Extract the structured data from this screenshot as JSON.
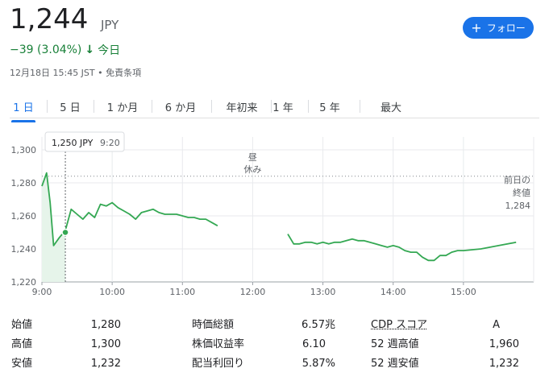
{
  "quote": {
    "price": "1,244",
    "currency": "JPY",
    "change": "−39 (3.04%)",
    "arrow": "↓",
    "period": "今日",
    "meta": "12月18日 15:45 JST • 免責条項"
  },
  "follow_button": {
    "icon": "+",
    "label": "フォロー"
  },
  "tabs": [
    {
      "label": "1 日",
      "active": true
    },
    {
      "label": "5 日",
      "active": false
    },
    {
      "label": "1 か月",
      "active": false
    },
    {
      "label": "6 か月",
      "active": false
    },
    {
      "label": "年初来",
      "active": false
    },
    {
      "label": "1 年",
      "active": false
    },
    {
      "label": "5 年",
      "active": false
    },
    {
      "label": "最大",
      "active": false
    }
  ],
  "chart_data": {
    "type": "line",
    "x_tick_labels": [
      "9:00",
      "10:00",
      "11:00",
      "12:00",
      "13:00",
      "14:00",
      "15:00"
    ],
    "y_tick_labels": [
      "1,300",
      "1,280",
      "1,260",
      "1,240",
      "1,220"
    ],
    "ylim": [
      1220,
      1300
    ],
    "previous_close": 1284,
    "previous_close_label": [
      "前日の",
      "終値",
      "1,284"
    ],
    "lunch_break_label": [
      "昼",
      "休み"
    ],
    "tooltip": {
      "price": "1,250 JPY",
      "time": "9:20"
    },
    "tooltip_point": {
      "x": "9:20",
      "y": 1250
    },
    "line_color": "#34a853",
    "fill_color": "#e6f4ea",
    "grid": true,
    "morning_session": {
      "x": [
        "9:00",
        "9:02",
        "9:04",
        "9:07",
        "9:10",
        "9:15",
        "9:20",
        "9:25",
        "9:30",
        "9:35",
        "9:40",
        "9:45",
        "9:50",
        "9:55",
        "10:00",
        "10:05",
        "10:10",
        "10:15",
        "10:20",
        "10:25",
        "10:30",
        "10:35",
        "10:40",
        "10:45",
        "10:50",
        "10:55",
        "11:00",
        "11:05",
        "11:10",
        "11:15",
        "11:20",
        "11:25",
        "11:30"
      ],
      "y": [
        1278,
        1282,
        1286,
        1268,
        1242,
        1247,
        1251,
        1264,
        1261,
        1258,
        1262,
        1259,
        1267,
        1266,
        1268,
        1265,
        1263,
        1261,
        1258,
        1262,
        1263,
        1264,
        1262,
        1261,
        1261,
        1261,
        1260,
        1259,
        1259,
        1258,
        1258,
        1256,
        1254
      ]
    },
    "afternoon_session": {
      "x": [
        "12:30",
        "12:35",
        "12:40",
        "12:45",
        "12:50",
        "12:55",
        "13:00",
        "13:05",
        "13:10",
        "13:15",
        "13:20",
        "13:25",
        "13:30",
        "13:35",
        "13:40",
        "13:45",
        "13:50",
        "13:55",
        "14:00",
        "14:05",
        "14:10",
        "14:15",
        "14:20",
        "14:25",
        "14:30",
        "14:35",
        "14:40",
        "14:45",
        "14:50",
        "14:55",
        "15:00",
        "15:15",
        "15:30",
        "15:45"
      ],
      "y": [
        1249,
        1243,
        1243,
        1244,
        1244,
        1243,
        1244,
        1243,
        1244,
        1244,
        1245,
        1246,
        1245,
        1245,
        1244,
        1243,
        1242,
        1241,
        1242,
        1241,
        1239,
        1238,
        1238,
        1235,
        1233,
        1233,
        1236,
        1236,
        1238,
        1239,
        1239,
        1240,
        1242,
        1244
      ]
    }
  },
  "stats": [
    {
      "label": "始値",
      "value": "1,280"
    },
    {
      "label": "高値",
      "value": "1,300"
    },
    {
      "label": "安値",
      "value": "1,232"
    },
    {
      "label": "時価総額",
      "value": "6.57兆"
    },
    {
      "label": "株価収益率",
      "value": "6.10"
    },
    {
      "label": "配当利回り",
      "value": "5.87%"
    },
    {
      "label": "CDP スコア",
      "value": "A"
    },
    {
      "label": "52 週高値",
      "value": "1,960"
    },
    {
      "label": "52 週安値",
      "value": "1,232"
    }
  ]
}
